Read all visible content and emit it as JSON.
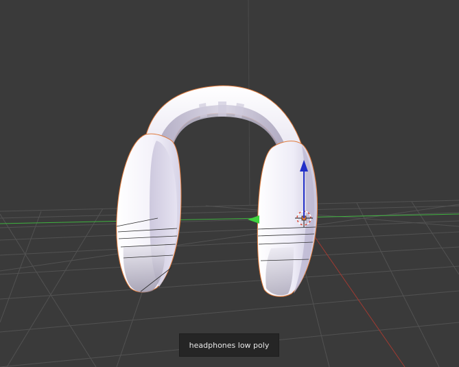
{
  "viewport": {
    "background": "#3a3a3a",
    "grid_color": "#555555",
    "x_axis_color": "#3fb33f",
    "y_axis_color": "#a03a32",
    "selection_outline_color": "#e07a3a"
  },
  "scene": {
    "object": "headphones-mesh",
    "icons": [
      "move-gizmo-z-arrow-icon",
      "move-gizmo-x-arrow-icon",
      "3d-cursor-icon",
      "object-origin-icon"
    ]
  },
  "caption": {
    "text": "headphones low poly"
  }
}
